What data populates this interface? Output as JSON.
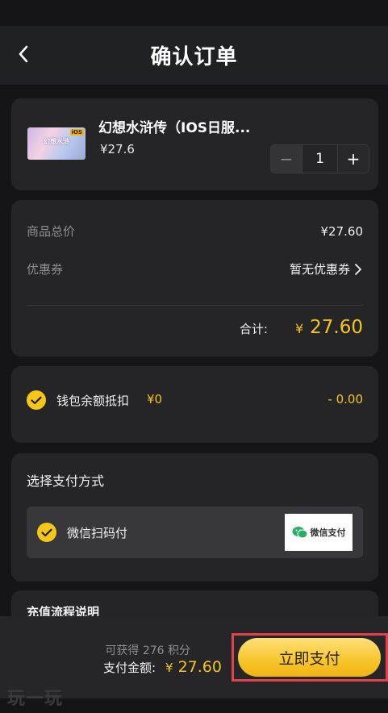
{
  "header": {
    "title": "确认订单"
  },
  "product": {
    "name": "幻想水浒传（IOS日服...",
    "price": "¥27.6",
    "quantity": "1",
    "decrement_symbol": "−",
    "increment_symbol": "+"
  },
  "summary": {
    "subtotal_label": "商品总价",
    "subtotal_value": "¥27.60",
    "coupon_label": "优惠券",
    "coupon_value": "暂无优惠券",
    "total_label": "合计:",
    "total_currency": "¥",
    "total_value": "27.60"
  },
  "wallet": {
    "label": "钱包余额抵扣",
    "balance": "¥0",
    "deduction": "- 0.00",
    "checked": true
  },
  "payment": {
    "section_title": "选择支付方式",
    "method_label": "微信扫码付",
    "method_logo_text": "微信支付",
    "checked": true
  },
  "recharge": {
    "section_title": "充值流程说明"
  },
  "footer": {
    "points_text": "可获得 276 积分",
    "pay_label": "支付金额:",
    "pay_currency": "¥",
    "pay_value": "27.60",
    "pay_button": "立即支付"
  },
  "watermark": {
    "text": "玩一玩"
  },
  "colors": {
    "accent": "#f5c518",
    "background": "#151517",
    "card": "#252528",
    "highlight": "#e0424b"
  }
}
